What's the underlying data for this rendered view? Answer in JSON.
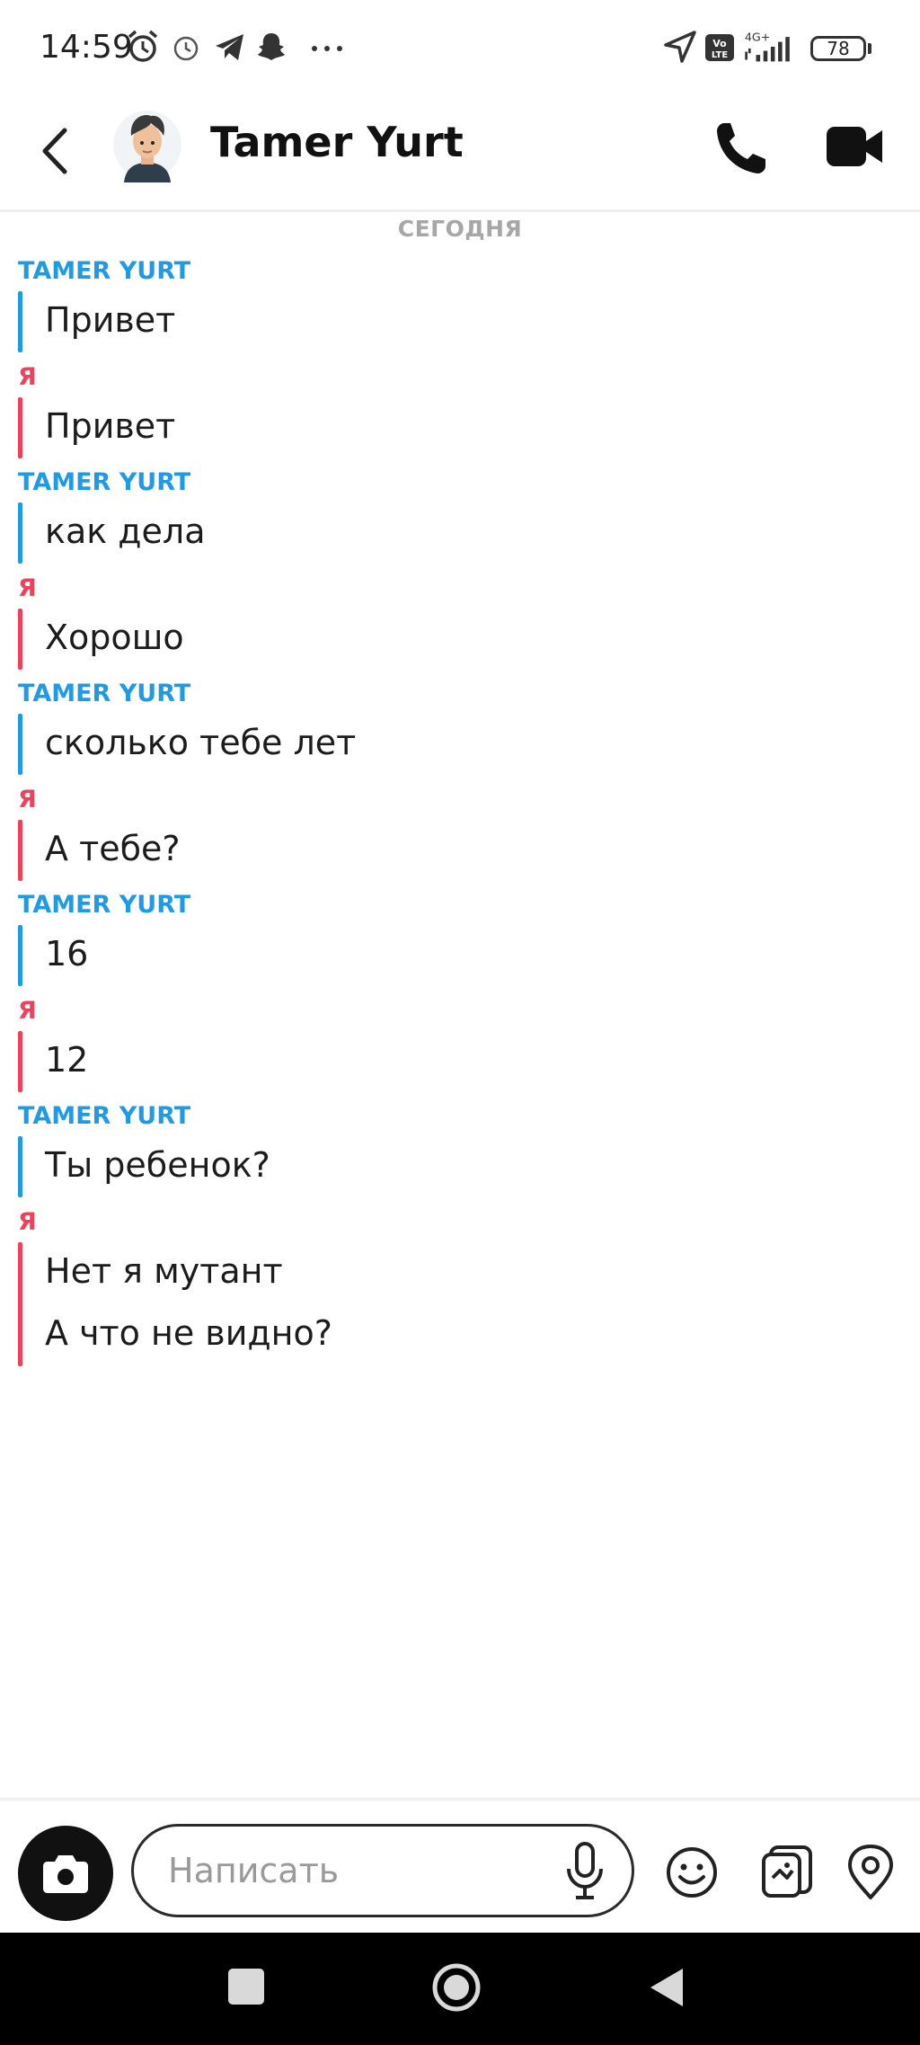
{
  "status_bar": {
    "time": "14:59",
    "network": "4G+",
    "volte": "Vo LTE",
    "battery": "78"
  },
  "header": {
    "contact_name": "Tamer Yurt",
    "icons": [
      "back-icon",
      "avatar",
      "phone-icon",
      "video-icon"
    ]
  },
  "chat": {
    "day_label": "СЕГОДНЯ",
    "messages": [
      {
        "sender": "TAMER YURT",
        "from": "them",
        "lines": [
          "Привет"
        ]
      },
      {
        "sender": "Я",
        "from": "me",
        "lines": [
          "Привет"
        ]
      },
      {
        "sender": "TAMER YURT",
        "from": "them",
        "lines": [
          "как дела"
        ]
      },
      {
        "sender": "Я",
        "from": "me",
        "lines": [
          "Хорошо"
        ]
      },
      {
        "sender": "TAMER YURT",
        "from": "them",
        "lines": [
          "сколько тебе лет"
        ]
      },
      {
        "sender": "Я",
        "from": "me",
        "lines": [
          "А тебе?"
        ]
      },
      {
        "sender": "TAMER YURT",
        "from": "them",
        "lines": [
          "16"
        ]
      },
      {
        "sender": "Я",
        "from": "me",
        "lines": [
          "12"
        ]
      },
      {
        "sender": "TAMER YURT",
        "from": "them",
        "lines": [
          "Ты ребенок?"
        ]
      },
      {
        "sender": "Я",
        "from": "me",
        "lines": [
          "Нет я мутант",
          "А что не видно?"
        ]
      }
    ]
  },
  "composer": {
    "placeholder": "Написать",
    "value": "",
    "icons": [
      "camera-icon",
      "microphone-icon",
      "emoji-icon",
      "sticker-icon",
      "location-icon"
    ]
  },
  "colors": {
    "them": "#1f9ae5",
    "me": "#f0405a"
  }
}
